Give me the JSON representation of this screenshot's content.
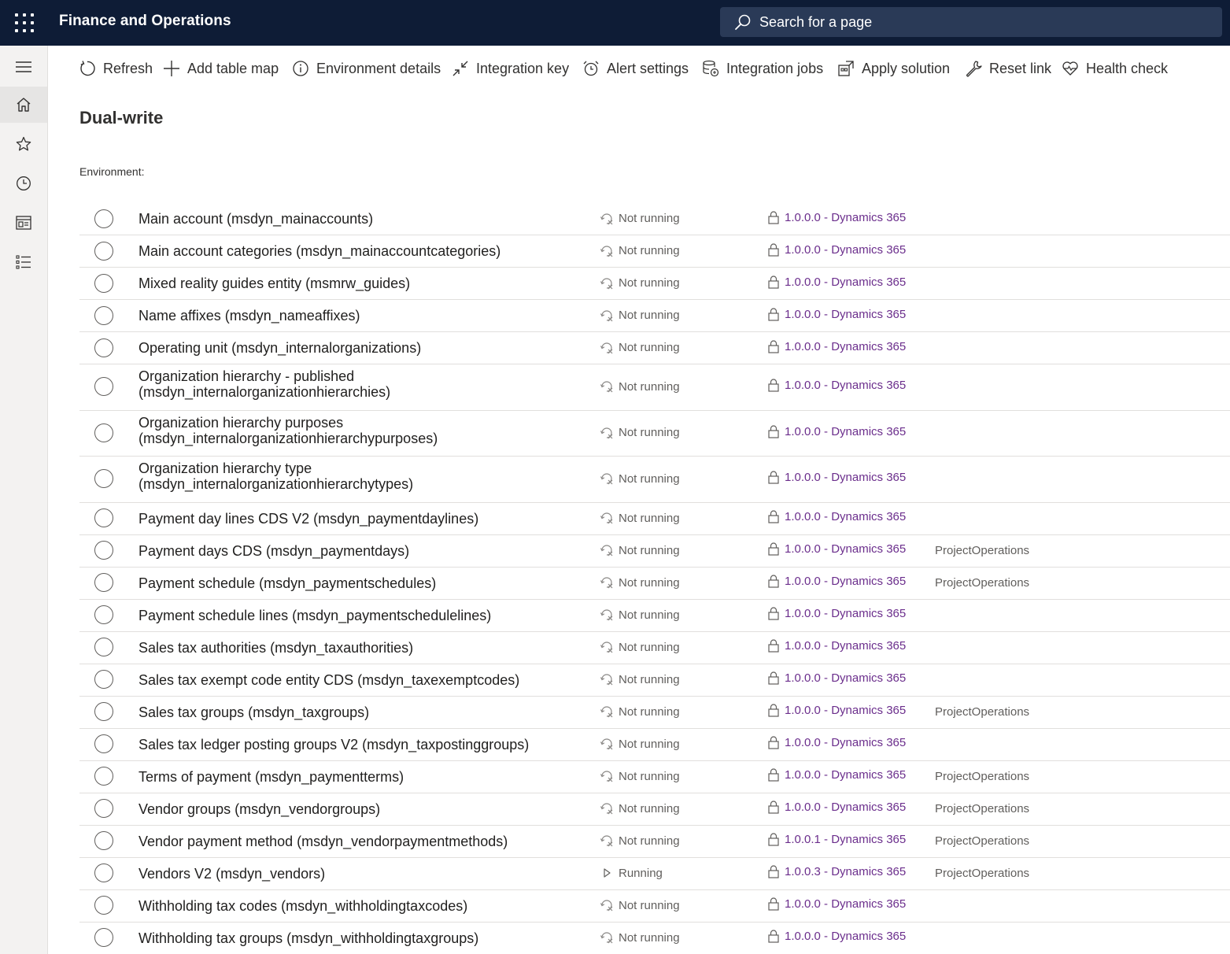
{
  "app": {
    "title": "Finance and Operations"
  },
  "search": {
    "placeholder": "Search for a page"
  },
  "toolbar": [
    {
      "id": "refresh",
      "label": "Refresh",
      "icon": "refresh-icon"
    },
    {
      "id": "add-table-map",
      "label": "Add table map",
      "icon": "plus-icon"
    },
    {
      "id": "environment-details",
      "label": "Environment details",
      "icon": "info-icon"
    },
    {
      "id": "integration-key",
      "label": "Integration key",
      "icon": "collapse-arrows-icon"
    },
    {
      "id": "alert-settings",
      "label": "Alert settings",
      "icon": "alarm-clock-icon"
    },
    {
      "id": "integration-jobs",
      "label": "Integration jobs",
      "icon": "database-sync-icon"
    },
    {
      "id": "apply-solution",
      "label": "Apply solution",
      "icon": "solution-package-icon"
    },
    {
      "id": "reset-link",
      "label": "Reset link",
      "icon": "wrench-icon"
    },
    {
      "id": "health-check",
      "label": "Health check",
      "icon": "heart-pulse-icon"
    }
  ],
  "page": {
    "title": "Dual-write",
    "environment_label": "Environment:"
  },
  "colors": {
    "topbar": "#0e1c36",
    "search_bg": "#2a3a57",
    "version_link": "#6b2e8c",
    "muted_text": "#605e5c"
  },
  "rows": [
    {
      "name": "Main account (msdyn_mainaccounts)",
      "status": "Not running",
      "version": "1.0.0.0 - Dynamics 365",
      "solution": ""
    },
    {
      "name": "Main account categories (msdyn_mainaccountcategories)",
      "status": "Not running",
      "version": "1.0.0.0 - Dynamics 365",
      "solution": ""
    },
    {
      "name": "Mixed reality guides entity (msmrw_guides)",
      "status": "Not running",
      "version": "1.0.0.0 - Dynamics 365",
      "solution": ""
    },
    {
      "name": "Name affixes (msdyn_nameaffixes)",
      "status": "Not running",
      "version": "1.0.0.0 - Dynamics 365",
      "solution": ""
    },
    {
      "name": "Operating unit (msdyn_internalorganizations)",
      "status": "Not running",
      "version": "1.0.0.0 - Dynamics 365",
      "solution": ""
    },
    {
      "name": "Organization hierarchy - published (msdyn_internalorganizationhierarchies)",
      "status": "Not running",
      "version": "1.0.0.0 - Dynamics 365",
      "solution": ""
    },
    {
      "name": "Organization hierarchy purposes (msdyn_internalorganizationhierarchypurposes)",
      "status": "Not running",
      "version": "1.0.0.0 - Dynamics 365",
      "solution": ""
    },
    {
      "name": "Organization hierarchy type (msdyn_internalorganizationhierarchytypes)",
      "status": "Not running",
      "version": "1.0.0.0 - Dynamics 365",
      "solution": ""
    },
    {
      "name": "Payment day lines CDS V2 (msdyn_paymentdaylines)",
      "status": "Not running",
      "version": "1.0.0.0 - Dynamics 365",
      "solution": ""
    },
    {
      "name": "Payment days CDS (msdyn_paymentdays)",
      "status": "Not running",
      "version": "1.0.0.0 - Dynamics 365",
      "solution": "ProjectOperations"
    },
    {
      "name": "Payment schedule (msdyn_paymentschedules)",
      "status": "Not running",
      "version": "1.0.0.0 - Dynamics 365",
      "solution": "ProjectOperations"
    },
    {
      "name": "Payment schedule lines (msdyn_paymentschedulelines)",
      "status": "Not running",
      "version": "1.0.0.0 - Dynamics 365",
      "solution": ""
    },
    {
      "name": "Sales tax authorities (msdyn_taxauthorities)",
      "status": "Not running",
      "version": "1.0.0.0 - Dynamics 365",
      "solution": ""
    },
    {
      "name": "Sales tax exempt code entity CDS (msdyn_taxexemptcodes)",
      "status": "Not running",
      "version": "1.0.0.0 - Dynamics 365",
      "solution": ""
    },
    {
      "name": "Sales tax groups (msdyn_taxgroups)",
      "status": "Not running",
      "version": "1.0.0.0 - Dynamics 365",
      "solution": "ProjectOperations"
    },
    {
      "name": "Sales tax ledger posting groups V2 (msdyn_taxpostinggroups)",
      "status": "Not running",
      "version": "1.0.0.0 - Dynamics 365",
      "solution": ""
    },
    {
      "name": "Terms of payment (msdyn_paymentterms)",
      "status": "Not running",
      "version": "1.0.0.0 - Dynamics 365",
      "solution": "ProjectOperations"
    },
    {
      "name": "Vendor groups (msdyn_vendorgroups)",
      "status": "Not running",
      "version": "1.0.0.0 - Dynamics 365",
      "solution": "ProjectOperations"
    },
    {
      "name": "Vendor payment method (msdyn_vendorpaymentmethods)",
      "status": "Not running",
      "version": "1.0.0.1 - Dynamics 365",
      "solution": "ProjectOperations"
    },
    {
      "name": "Vendors V2 (msdyn_vendors)",
      "status": "Running",
      "version": "1.0.0.3 - Dynamics 365",
      "solution": "ProjectOperations"
    },
    {
      "name": "Withholding tax codes (msdyn_withholdingtaxcodes)",
      "status": "Not running",
      "version": "1.0.0.0 - Dynamics 365",
      "solution": ""
    },
    {
      "name": "Withholding tax groups (msdyn_withholdingtaxgroups)",
      "status": "Not running",
      "version": "1.0.0.0 - Dynamics 365",
      "solution": ""
    }
  ]
}
